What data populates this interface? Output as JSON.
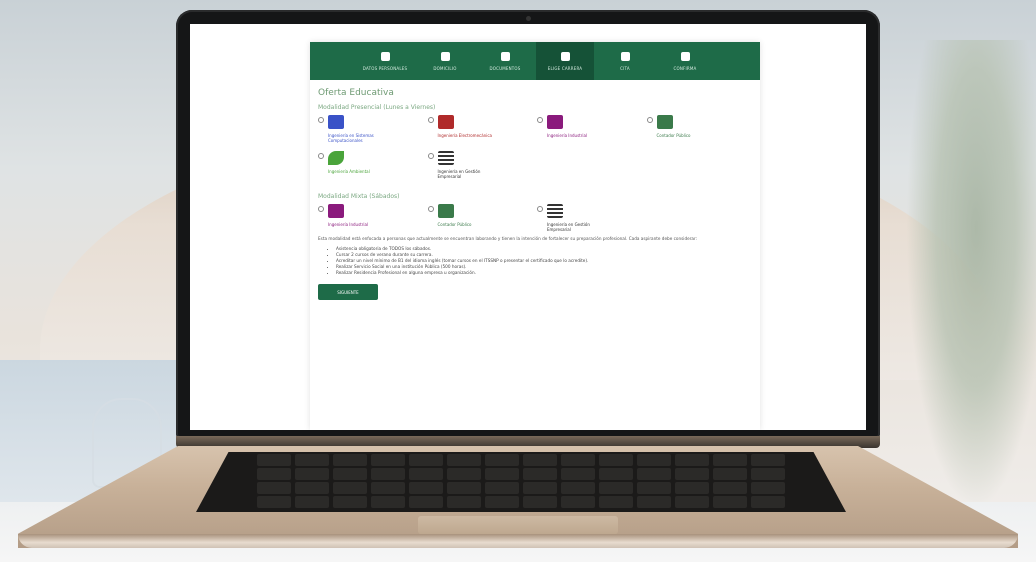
{
  "nav": {
    "items": [
      {
        "label": "DATOS PERSONALES",
        "active": false
      },
      {
        "label": "DOMICILIO",
        "active": false
      },
      {
        "label": "DOCUMENTOS",
        "active": false
      },
      {
        "label": "ELIGE CARRERA",
        "active": true
      },
      {
        "label": "CITA",
        "active": false
      },
      {
        "label": "CONFIRMA",
        "active": false
      }
    ]
  },
  "page": {
    "title": "Oferta Educativa",
    "section1_title": "Modalidad Presencial (Lunes a Viernes)",
    "section1_options": [
      {
        "label": "Ingeniería en Sistemas Computacionales",
        "color": "#3a52c7",
        "icon": "laptop-phone-icon"
      },
      {
        "label": "Ingeniería Electromecánica",
        "color": "#b02a2a",
        "icon": "gear-icon"
      },
      {
        "label": "Ingeniería Industrial",
        "color": "#8a1a7c",
        "icon": "factory-icon"
      },
      {
        "label": "Contador Público",
        "color": "#3a7a4a",
        "icon": "document-icon"
      },
      {
        "label": "Ingeniería Ambiental",
        "color": "#4aa43a",
        "icon": "leaf-icon"
      },
      {
        "label": "Ingeniería en Gestión Empresarial",
        "color": "#333333",
        "icon": "checklist-icon"
      }
    ],
    "section2_title": "Modalidad Mixta (Sábados)",
    "section2_options": [
      {
        "label": "Ingeniería Industrial",
        "color": "#8a1a7c",
        "icon": "factory-icon"
      },
      {
        "label": "Contador Público",
        "color": "#3a7a4a",
        "icon": "document-icon"
      },
      {
        "label": "Ingeniería en Gestión Empresarial",
        "color": "#333333",
        "icon": "checklist-icon"
      }
    ],
    "description": "Esta modalidad está enfocada a personas que actualmente se encuentran laborando y tienen la intención de fortalecer su preparación profesional. Cada aspirante debe considerar:",
    "bullets": [
      "Asistencia obligatoria de TODOS los sábados.",
      "Cursar 2 cursos de verano durante su carrera.",
      "Acreditar un nivel mínimo de B1 del idioma inglés (tomar cursos en el ITSSNP o presentar el certificado que lo acredite).",
      "Realizar Servicio Social en una institución Pública (500 horas).",
      "Realizar Residencia Profesional en alguna empresa u organización."
    ],
    "cta_label": "SIGUIENTE"
  }
}
